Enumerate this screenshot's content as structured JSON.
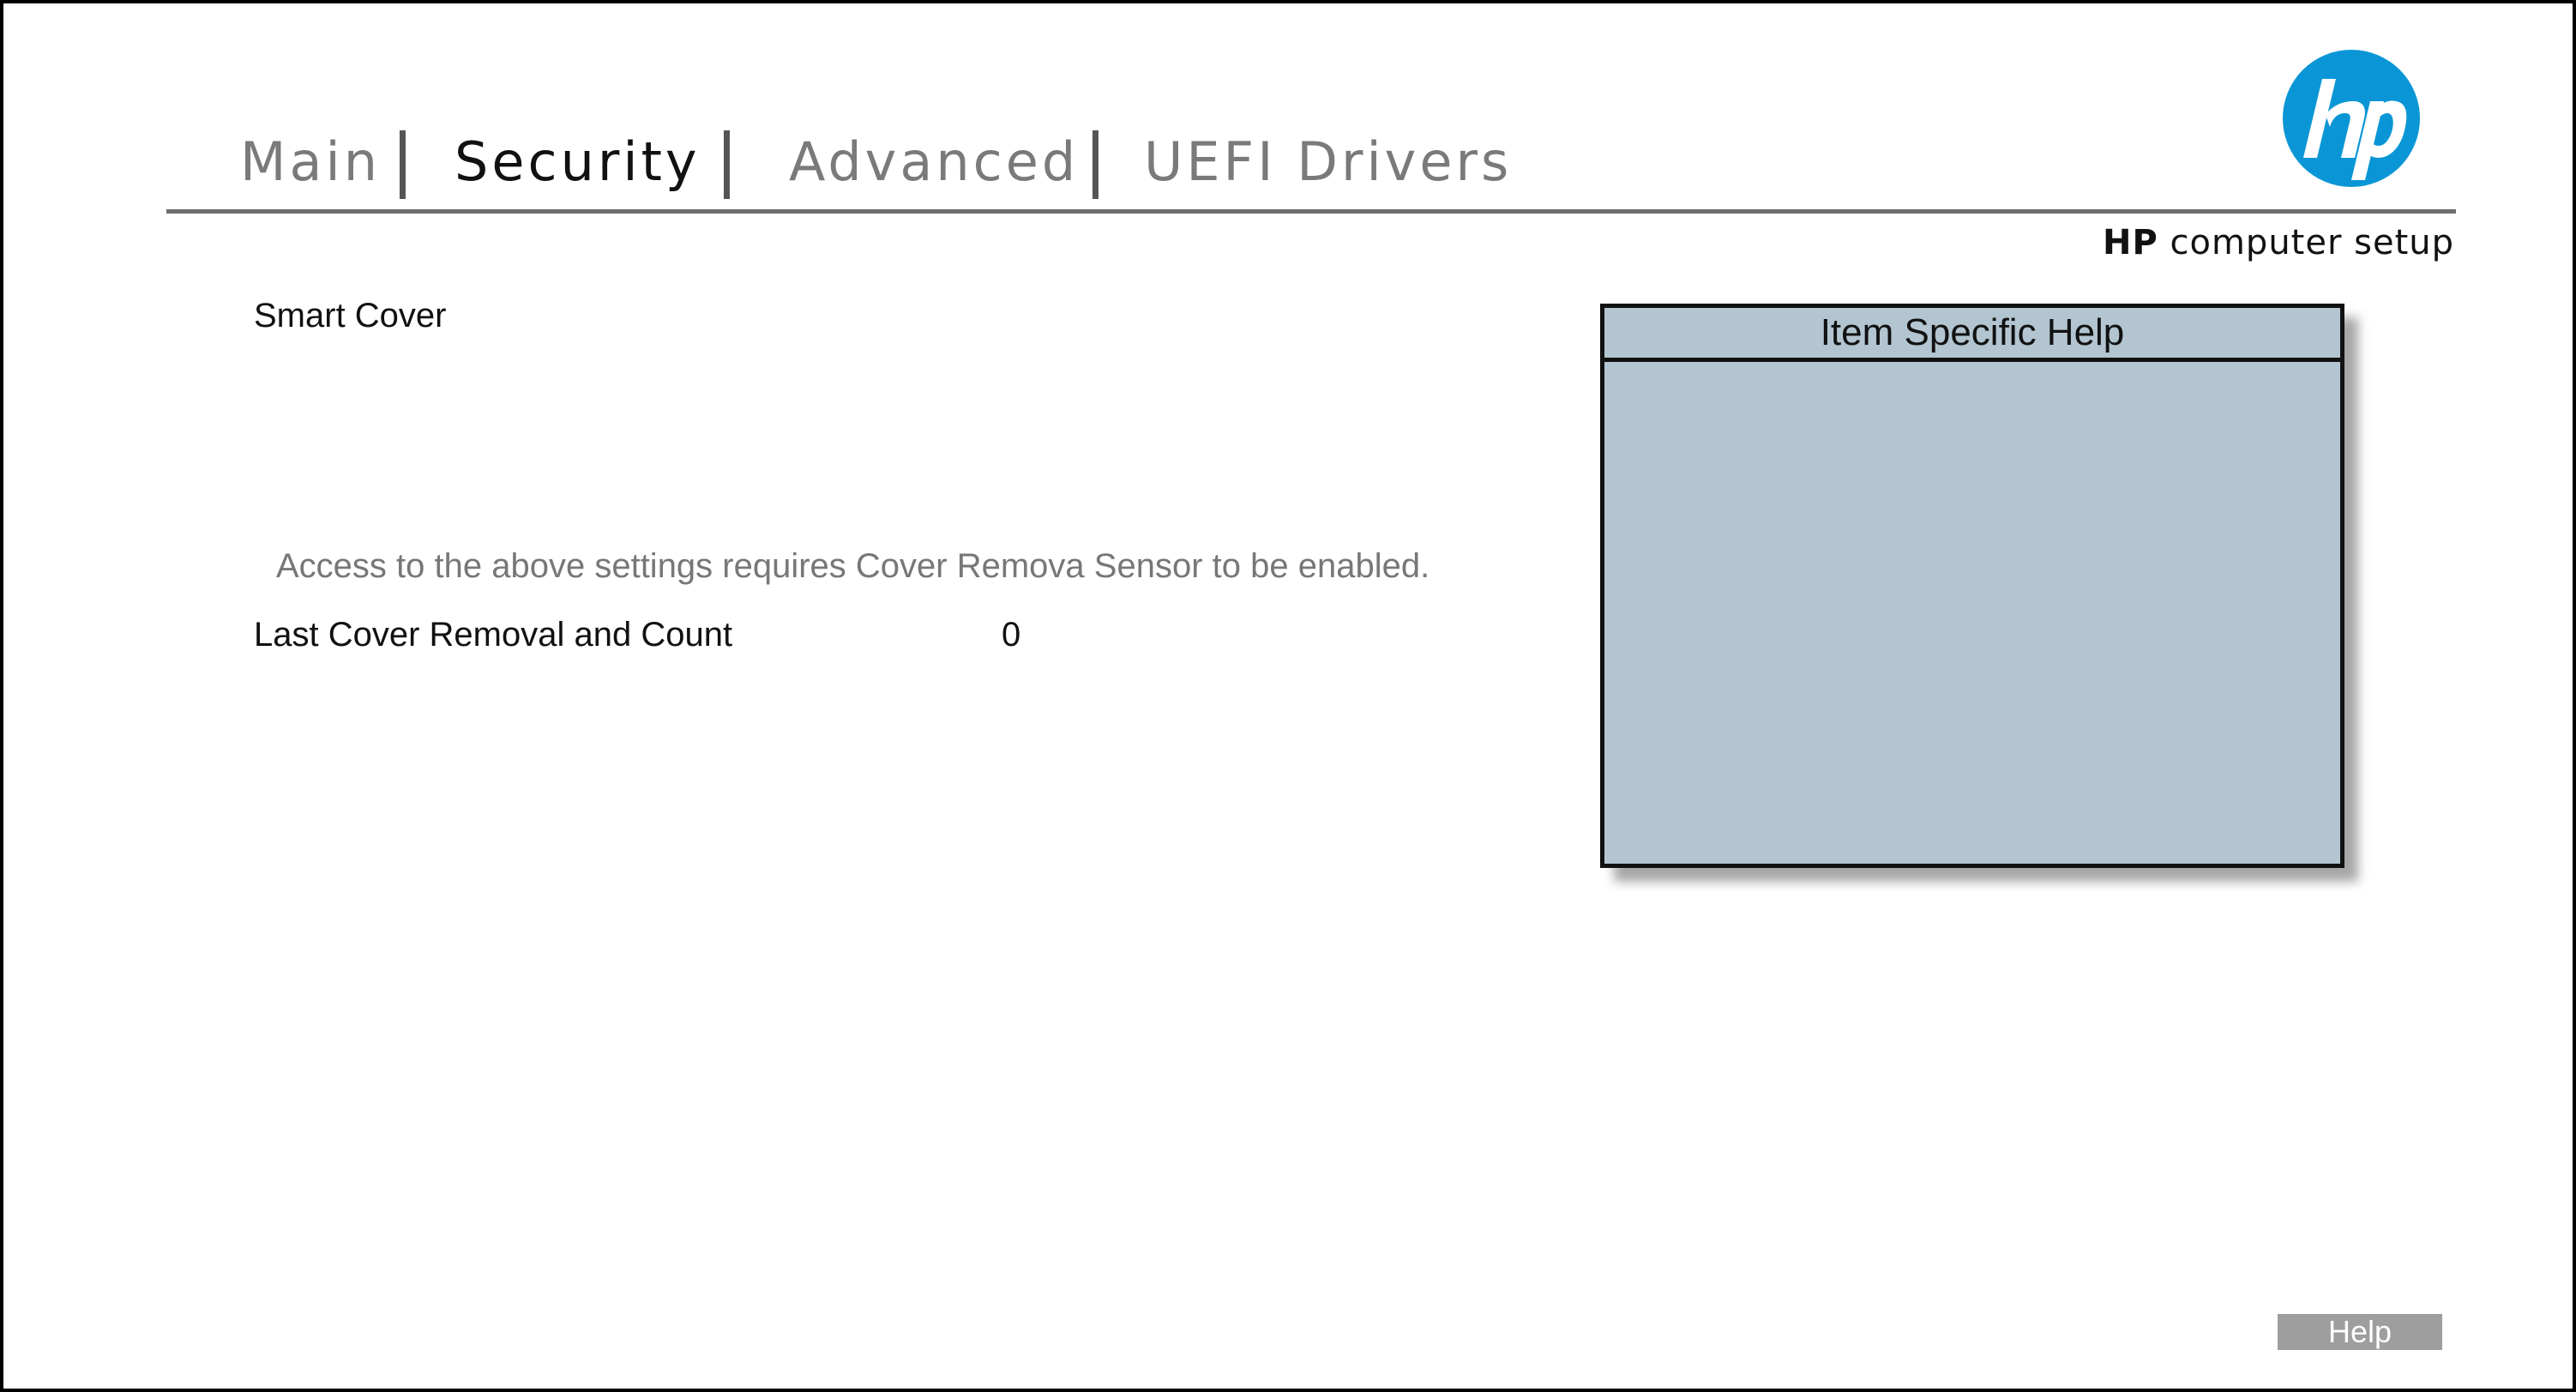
{
  "tabs": [
    {
      "label": "Main",
      "active": false
    },
    {
      "label": "Security",
      "active": true
    },
    {
      "label": "Advanced",
      "active": false
    },
    {
      "label": "UEFI Drivers",
      "active": false
    }
  ],
  "brand": {
    "logo": "hp-logo",
    "hp": "HP",
    "text": "computer setup"
  },
  "section": {
    "title": "Smart Cover",
    "note": "Access to the above settings requires Cover Remova Sensor to be enabled.",
    "rows": [
      {
        "label": "Last Cover Removal and Count",
        "value": "0"
      }
    ]
  },
  "help_panel": {
    "title": "Item Specific Help",
    "body": ""
  },
  "footer": {
    "help_button": "Help"
  },
  "colors": {
    "active_tab": "#111111",
    "inactive_tab": "#7a7a7a",
    "help_panel_bg": "#b2c5d0",
    "logo_blue": "#0a96d6",
    "help_button_bg": "#9e9e9e",
    "note_text": "#777777"
  }
}
